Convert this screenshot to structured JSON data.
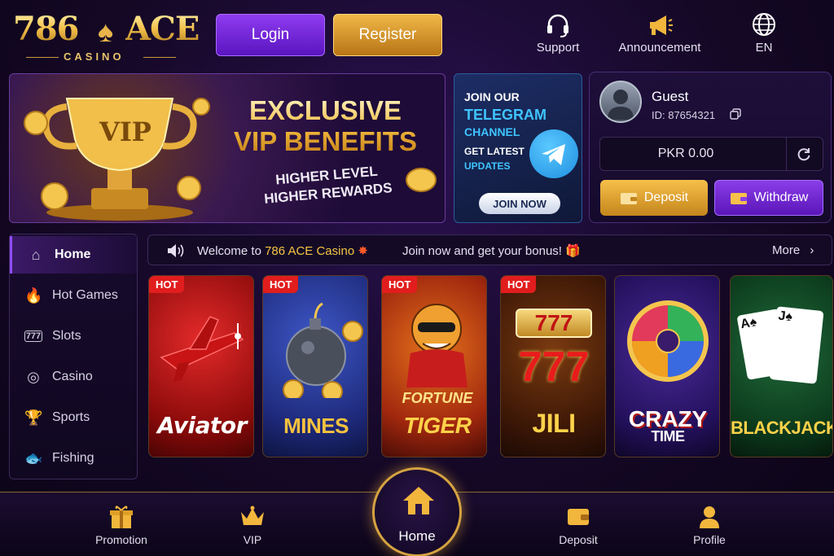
{
  "brand": {
    "name": "786",
    "name2": "ACE",
    "sub": "CASINO"
  },
  "header": {
    "login_label": "Login",
    "register_label": "Register",
    "support_label": "Support",
    "announcement_label": "Announcement",
    "language_label": "EN"
  },
  "hero": {
    "title_line1": "EXCLUSIVE",
    "title_line2": "VIP BENEFITS",
    "sub_line1": "HIGHER LEVEL",
    "sub_line2": "HIGHER REWARDS",
    "trophy_text": "VIP"
  },
  "telegram": {
    "line1": "JOIN OUR",
    "line2": "TELEGRAM",
    "line3": "CHANNEL",
    "line4": "GET LATEST",
    "line5": "UPDATES",
    "button_label": "JOIN NOW"
  },
  "account": {
    "username": "Guest",
    "id_text": "ID: 87654321",
    "balance": "PKR 0.00",
    "deposit_label": "Deposit",
    "withdraw_label": "Withdraw"
  },
  "sidebar": {
    "items": [
      {
        "label": "Home",
        "icon": "home-icon"
      },
      {
        "label": "Hot Games",
        "icon": "flame-icon"
      },
      {
        "label": "Slots",
        "icon": "slots-icon"
      },
      {
        "label": "Casino",
        "icon": "chip-icon"
      },
      {
        "label": "Sports",
        "icon": "trophy-icon"
      },
      {
        "label": "Fishing",
        "icon": "fish-icon"
      }
    ]
  },
  "marquee": {
    "welcome_prefix": "Welcome to ",
    "welcome_brand": "786 ACE Casino",
    "promo_text": "Join now and get your bonus!",
    "more_label": "More"
  },
  "games": [
    {
      "name": "Aviator",
      "hot": "HOT"
    },
    {
      "name": "MINES",
      "hot": "HOT"
    },
    {
      "name": "FORTUNE",
      "name2": "TIGER",
      "hot": "HOT"
    },
    {
      "name": "JILI",
      "hot": "HOT",
      "reels": "777"
    },
    {
      "name": "CRAZY",
      "name2": "TIME"
    },
    {
      "name": "BLACKJACK"
    }
  ],
  "bottom_nav": {
    "promotion_label": "Promotion",
    "vip_label": "VIP",
    "home_label": "Home",
    "deposit_label": "Deposit",
    "profile_label": "Profile"
  },
  "colors": {
    "purple": "#7a2ee0",
    "gold": "#f0b840",
    "hot_red": "#e11d1d"
  }
}
